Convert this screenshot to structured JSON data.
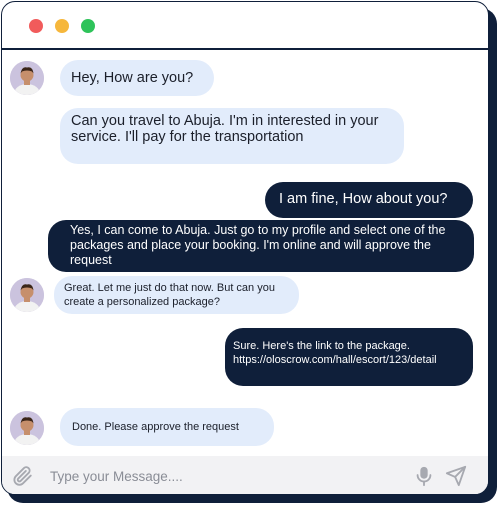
{
  "window": {
    "controls": [
      "close",
      "minimize",
      "maximize"
    ]
  },
  "messages": [
    {
      "direction": "incoming",
      "avatar": true,
      "text": "Hey, How are you?"
    },
    {
      "direction": "incoming",
      "avatar": false,
      "text": "Can you travel to Abuja. I'm in interested in your service. I'll pay for the transportation"
    },
    {
      "direction": "outgoing",
      "text": "I am fine, How about you?"
    },
    {
      "direction": "outgoing",
      "text": "Yes, I can come to Abuja. Just go to my profile and select one of the packages and place your booking. I'm online and will approve the request"
    },
    {
      "direction": "incoming",
      "avatar": true,
      "text": "Great. Let me just do that now. But can you create a personalized package?"
    },
    {
      "direction": "outgoing",
      "text": "Sure. Here's the link to the package. https://oloscrow.com/hall/escort/123/detail"
    },
    {
      "direction": "incoming",
      "avatar": true,
      "text": "Done. Please approve the request"
    }
  ],
  "composer": {
    "placeholder": "Type your Message....",
    "value": "",
    "icons": [
      "paperclip-icon",
      "microphone-icon",
      "send-icon"
    ]
  },
  "colors": {
    "dark_navy": "#0f1f3a",
    "incoming_bubble": "#e2ecfb",
    "close": "#f15b5b",
    "minimize": "#f6b73c",
    "maximize": "#2ec35a"
  }
}
